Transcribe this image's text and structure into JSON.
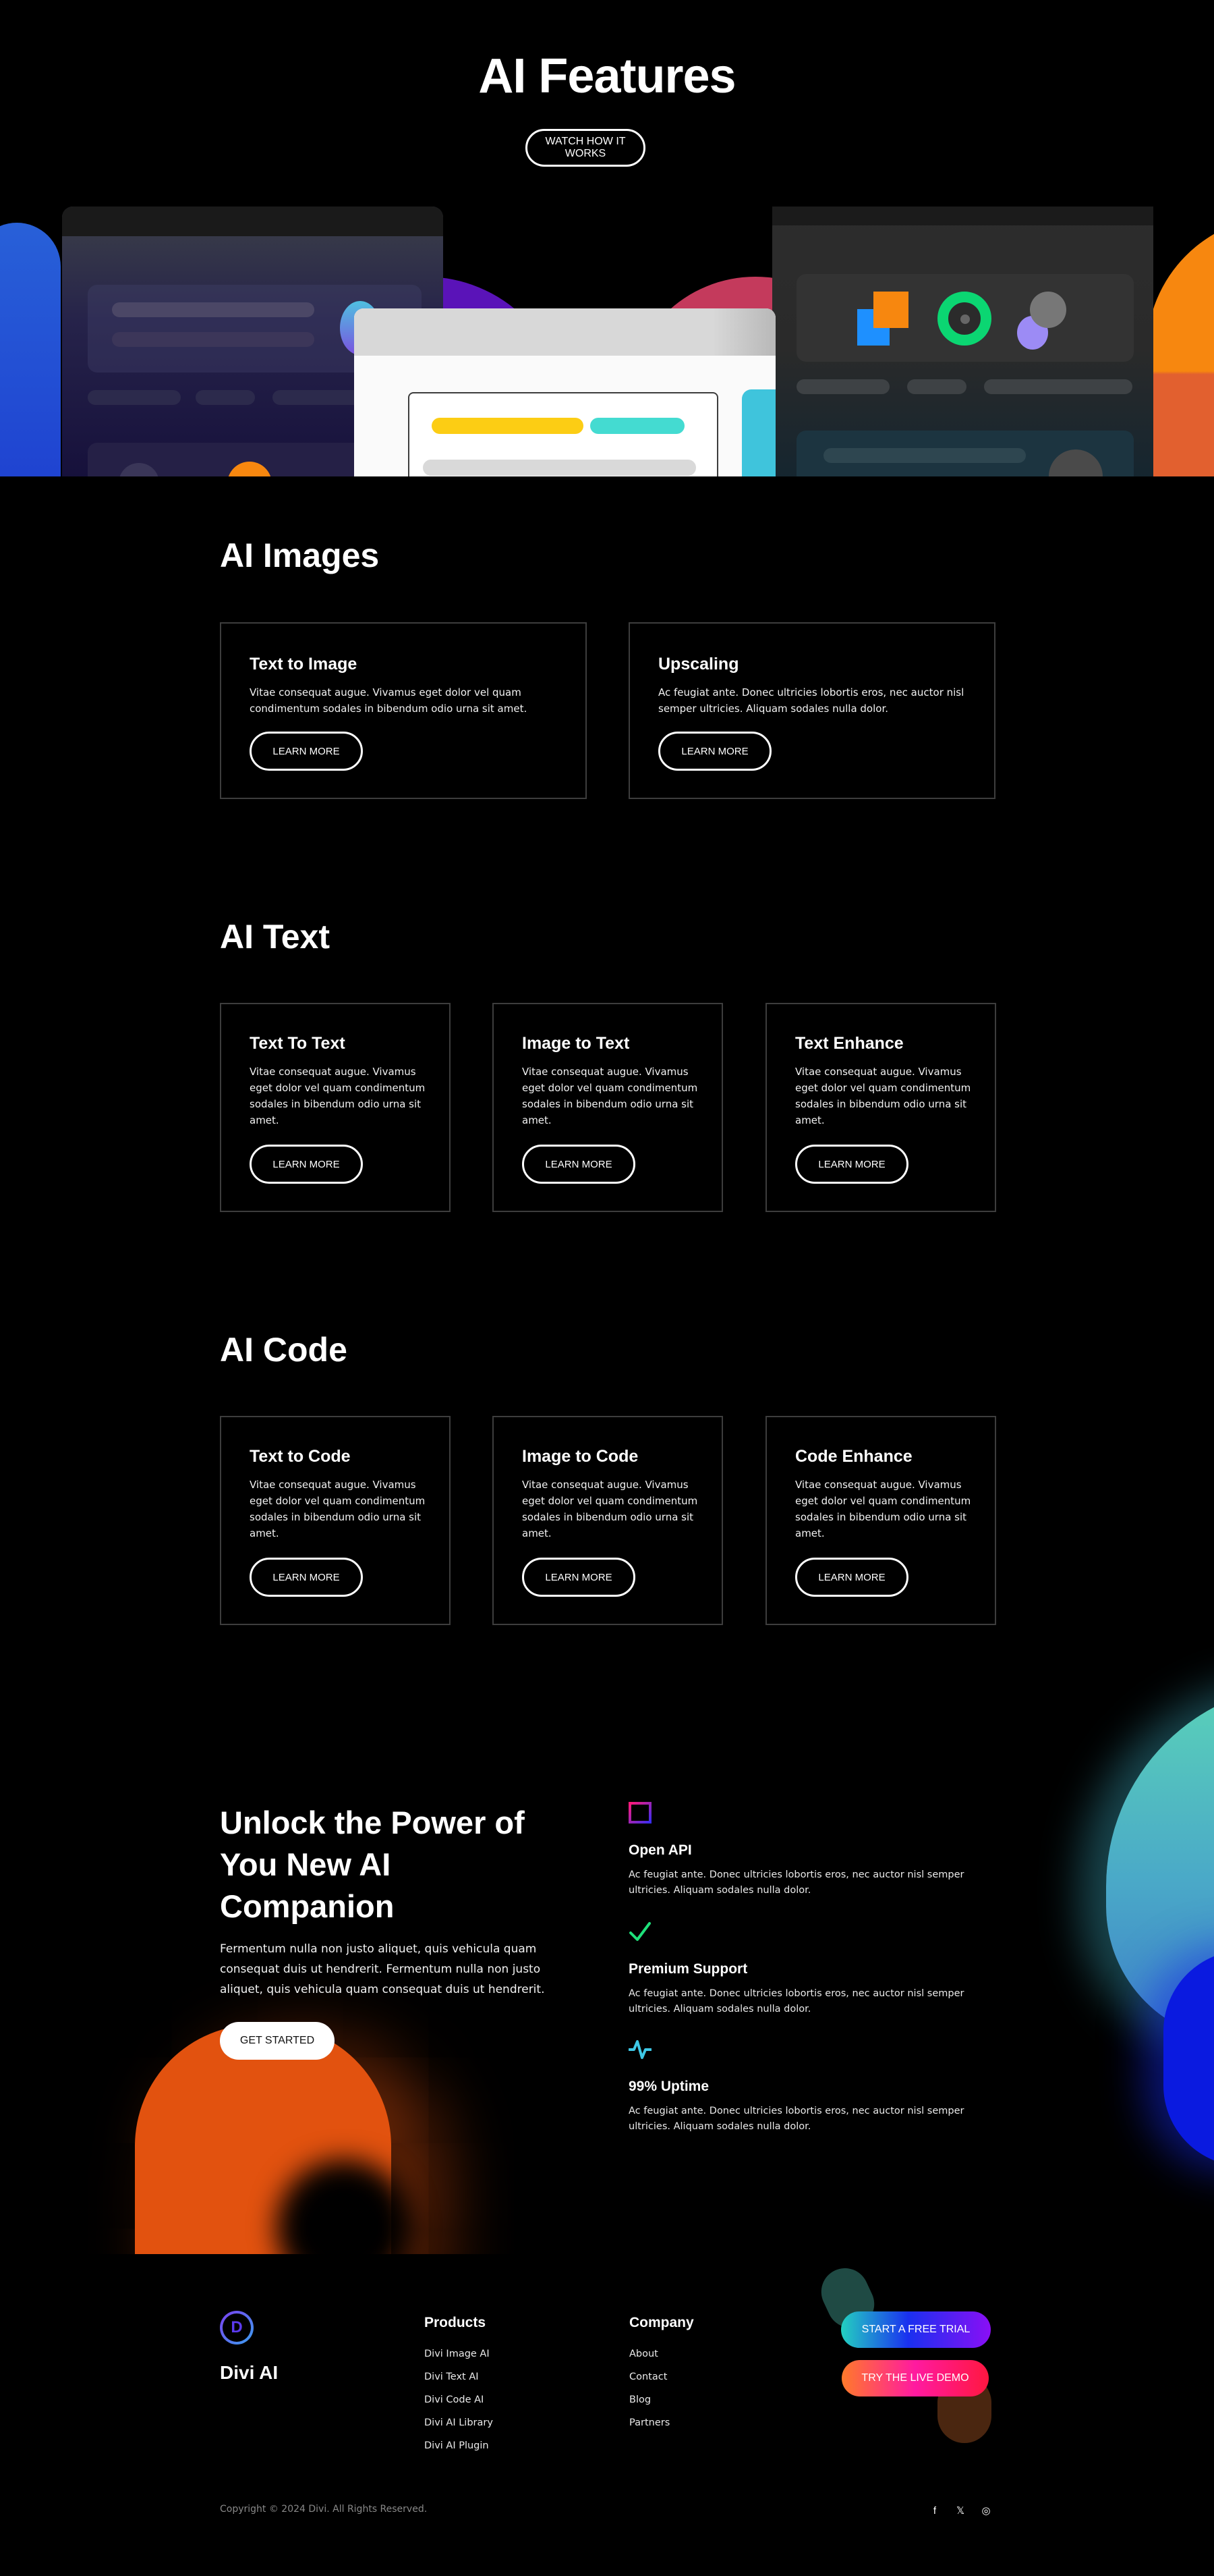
{
  "hero": {
    "title": "AI Features",
    "cta_label": "WATCH HOW IT WORKS"
  },
  "sections": [
    {
      "title": "AI Images",
      "cards": [
        {
          "title": "Text to Image",
          "description": "Vitae consequat augue. Vivamus eget dolor vel quam condimentum sodales in bibendum odio urna sit amet.",
          "button": "LEARN MORE"
        },
        {
          "title": "Upscaling",
          "description": "Ac feugiat ante. Donec ultricies lobortis eros, nec auctor nisl semper ultricies. Aliquam sodales nulla dolor.",
          "button": "LEARN MORE"
        }
      ]
    },
    {
      "title": "AI Text",
      "cards": [
        {
          "title": "Text To Text",
          "description": "Vitae consequat augue. Vivamus eget dolor vel quam condimentum sodales in bibendum odio urna sit amet.",
          "button": "LEARN MORE"
        },
        {
          "title": "Image to Text",
          "description": "Vitae consequat augue. Vivamus eget dolor vel quam condimentum sodales in bibendum odio urna sit amet.",
          "button": "LEARN MORE"
        },
        {
          "title": "Text Enhance",
          "description": "Vitae consequat augue. Vivamus eget dolor vel quam condimentum sodales in bibendum odio urna sit amet.",
          "button": "LEARN MORE"
        }
      ]
    },
    {
      "title": "AI Code",
      "cards": [
        {
          "title": "Text to Code",
          "description": "Vitae consequat augue. Vivamus eget dolor vel quam condimentum sodales in bibendum odio urna sit amet.",
          "button": "LEARN MORE"
        },
        {
          "title": "Image to Code",
          "description": "Vitae consequat augue. Vivamus eget dolor vel quam condimentum sodales in bibendum odio urna sit amet.",
          "button": "LEARN MORE"
        },
        {
          "title": "Code Enhance",
          "description": "Vitae consequat augue. Vivamus eget dolor vel quam condimentum sodales in bibendum odio urna sit amet.",
          "button": "LEARN MORE"
        }
      ]
    }
  ],
  "unlock": {
    "title": "Unlock the Power of You New AI Companion",
    "description": "Fermentum nulla non justo aliquet, quis vehicula quam consequat duis ut hendrerit. Fermentum nulla non justo aliquet, quis vehicula quam consequat duis ut hendrerit.",
    "cta_label": "GET STARTED",
    "features": [
      {
        "icon": "columns-icon",
        "title": "Open API",
        "description": "Ac feugiat ante. Donec ultricies lobortis eros, nec auctor nisl semper ultricies. Aliquam sodales nulla dolor."
      },
      {
        "icon": "checkmark-icon",
        "title": "Premium Support",
        "description": "Ac feugiat ante. Donec ultricies lobortis eros, nec auctor nisl semper ultricies. Aliquam sodales nulla dolor."
      },
      {
        "icon": "pulse-icon",
        "title": "99% Uptime",
        "description": "Ac feugiat ante. Donec ultricies lobortis eros, nec auctor nisl semper ultricies. Aliquam sodales nulla dolor."
      }
    ]
  },
  "footer": {
    "logo_letter": "D",
    "brand": "Divi AI",
    "products_title": "Products",
    "products": [
      "Divi Image AI",
      "Divi Text AI",
      "Divi Code AI",
      "Divi AI Library",
      "Divi AI Plugin"
    ],
    "company_title": "Company",
    "company": [
      "About",
      "Contact",
      "Blog",
      "Partners"
    ],
    "trial_label": "START A FREE TRIAL",
    "demo_label": "TRY THE LIVE DEMO",
    "copyright": "Copyright © 2024 Divi. All Rights Reserved.",
    "social": [
      {
        "name": "facebook-icon",
        "glyph": "f"
      },
      {
        "name": "x-icon",
        "glyph": "𝕏"
      },
      {
        "name": "instagram-icon",
        "glyph": "◎"
      }
    ]
  },
  "colors": {
    "background": "#000000",
    "card_border": "#3d3d3d",
    "accent_orange": "#e2520f",
    "accent_teal": "#5ad2b8",
    "accent_blue": "#0a1ae0",
    "check_green": "#1ee07a",
    "pulse_cyan": "#3ec8e6"
  }
}
